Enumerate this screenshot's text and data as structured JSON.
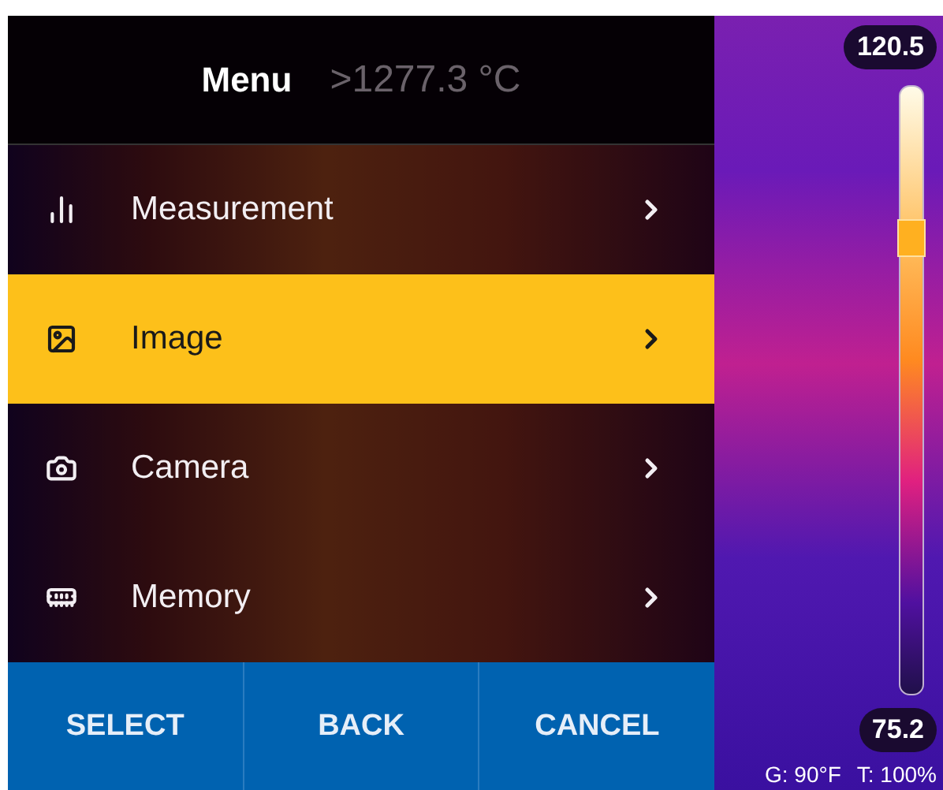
{
  "header": {
    "title": "Menu",
    "background_reading": ">1277.3 °C"
  },
  "menu": [
    {
      "label": "Measurement",
      "selected": false
    },
    {
      "label": "Image",
      "selected": true
    },
    {
      "label": "Camera",
      "selected": false
    },
    {
      "label": "Memory",
      "selected": false
    }
  ],
  "buttons": [
    "SELECT",
    "BACK",
    "CANCEL"
  ],
  "scale": {
    "max": "120.5",
    "min": "75.2",
    "level": 0.75
  },
  "status": {
    "gain": "G: 90°F",
    "transparency": "T: 100%"
  }
}
